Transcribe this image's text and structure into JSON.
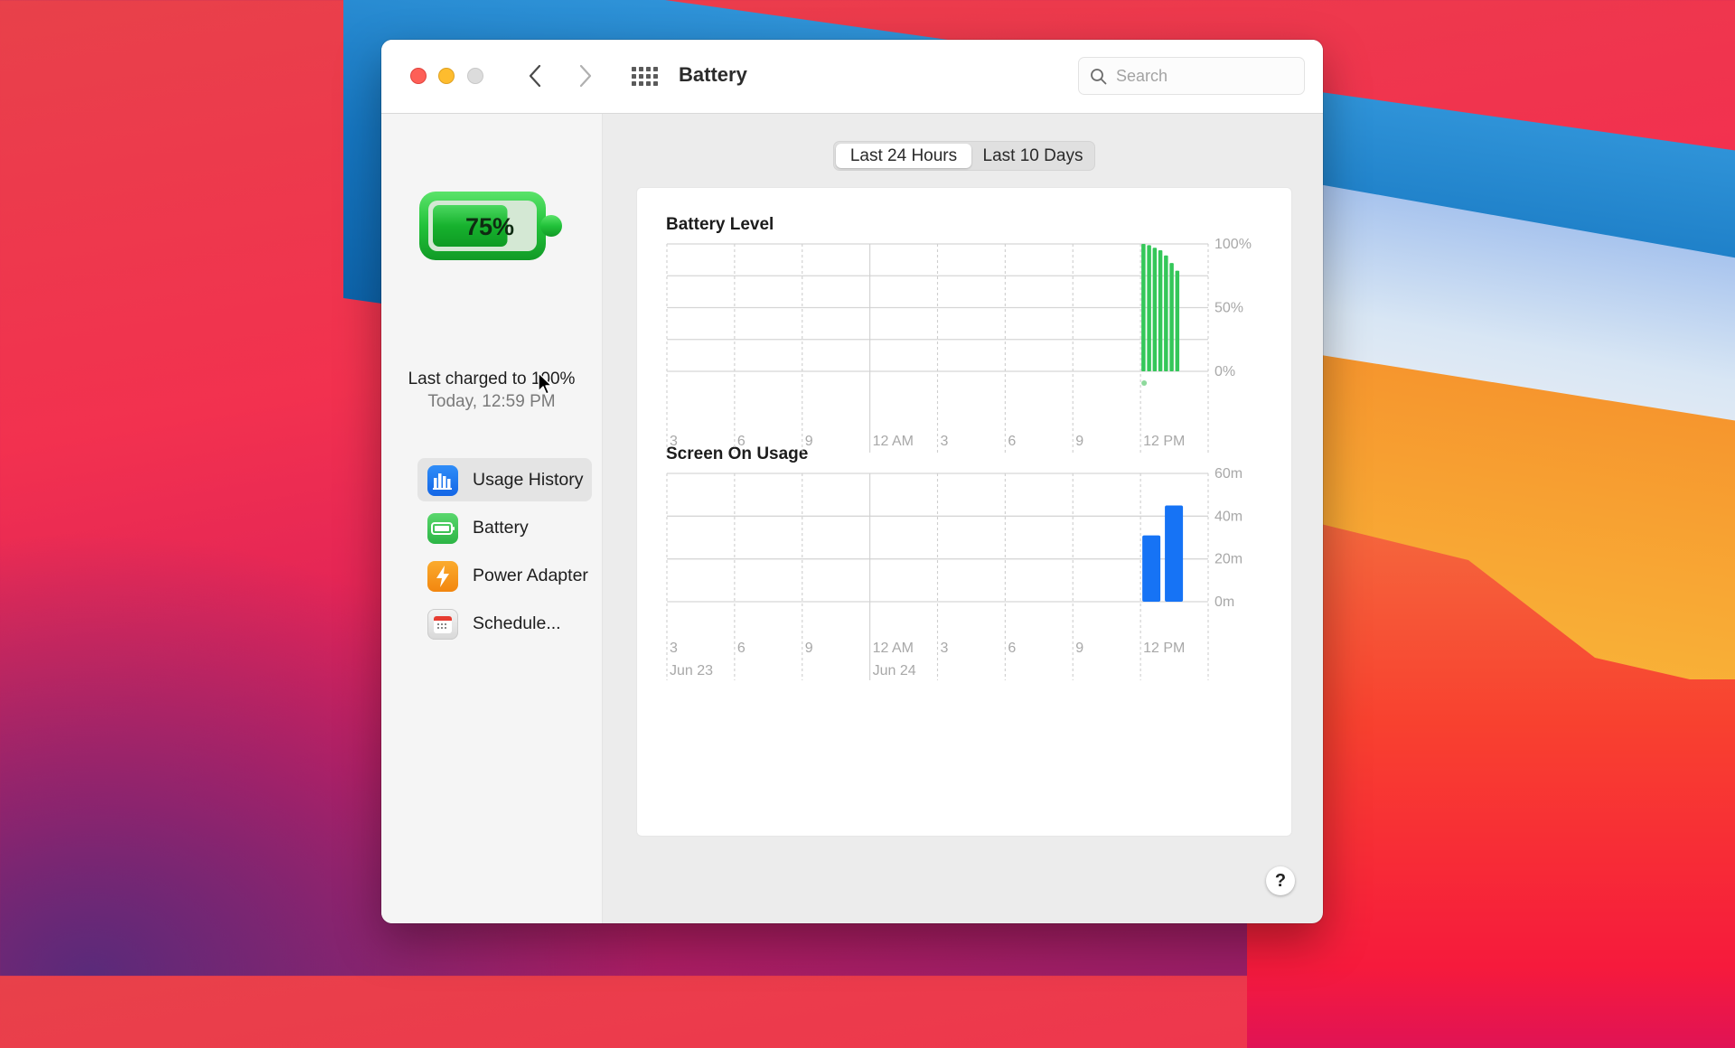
{
  "window": {
    "title": "Battery",
    "traffic_lights": [
      "close",
      "minimize",
      "zoom"
    ],
    "nav": {
      "back_icon": "chevron-left-icon",
      "forward_icon": "chevron-right-icon",
      "show_all_icon": "grid-icon"
    },
    "search": {
      "placeholder": "Search",
      "value": ""
    }
  },
  "sidebar": {
    "battery_percent_label": "75%",
    "battery_level_fraction": 0.75,
    "last_charged_label": "Last charged to 100%",
    "last_charged_time": "Today, 12:59 PM",
    "items": [
      {
        "label": "Usage History",
        "icon": "usage-history-icon",
        "active": true,
        "color": "#1a7cf5"
      },
      {
        "label": "Battery",
        "icon": "battery-icon",
        "active": false,
        "color": "#35c759"
      },
      {
        "label": "Power Adapter",
        "icon": "power-adapter-icon",
        "active": false,
        "color": "#f7961d"
      },
      {
        "label": "Schedule...",
        "icon": "schedule-icon",
        "active": false,
        "color": "#e5e5e5"
      }
    ]
  },
  "segmented": {
    "options": [
      "Last 24 Hours",
      "Last 10 Days"
    ],
    "selected": "Last 24 Hours"
  },
  "help_label": "?",
  "chart_data": [
    {
      "type": "bar",
      "title": "Battery Level",
      "color": "#34c759",
      "y_tick_labels": [
        "100%",
        "50%",
        "0%"
      ],
      "ylim": [
        0,
        100
      ],
      "x_tick_labels": [
        "3",
        "6",
        "9",
        "12 AM",
        "3",
        "6",
        "9",
        "12 PM"
      ],
      "x_range_hours": [
        24,
        0
      ],
      "grid": true,
      "charging_indicator_hour_offset": 3.0,
      "series": [
        {
          "name": "Battery Level",
          "x_hours_from_start": [
            21.0,
            21.25,
            21.5,
            21.75,
            22.0,
            22.25,
            22.5
          ],
          "values": [
            100,
            99,
            97,
            95,
            91,
            85,
            79
          ]
        }
      ]
    },
    {
      "type": "bar",
      "title": "Screen On Usage",
      "color": "#1673f5",
      "y_tick_labels": [
        "60m",
        "40m",
        "20m",
        "0m"
      ],
      "ylim": [
        0,
        60
      ],
      "x_tick_labels": [
        "3",
        "6",
        "9",
        "12 AM",
        "3",
        "6",
        "9",
        "12 PM"
      ],
      "date_labels": [
        "Jun 23",
        "Jun 24"
      ],
      "grid": true,
      "series": [
        {
          "name": "Screen On Usage (minutes)",
          "x_hours_from_start": [
            21.0,
            22.0
          ],
          "values": [
            31,
            45
          ]
        }
      ]
    }
  ]
}
